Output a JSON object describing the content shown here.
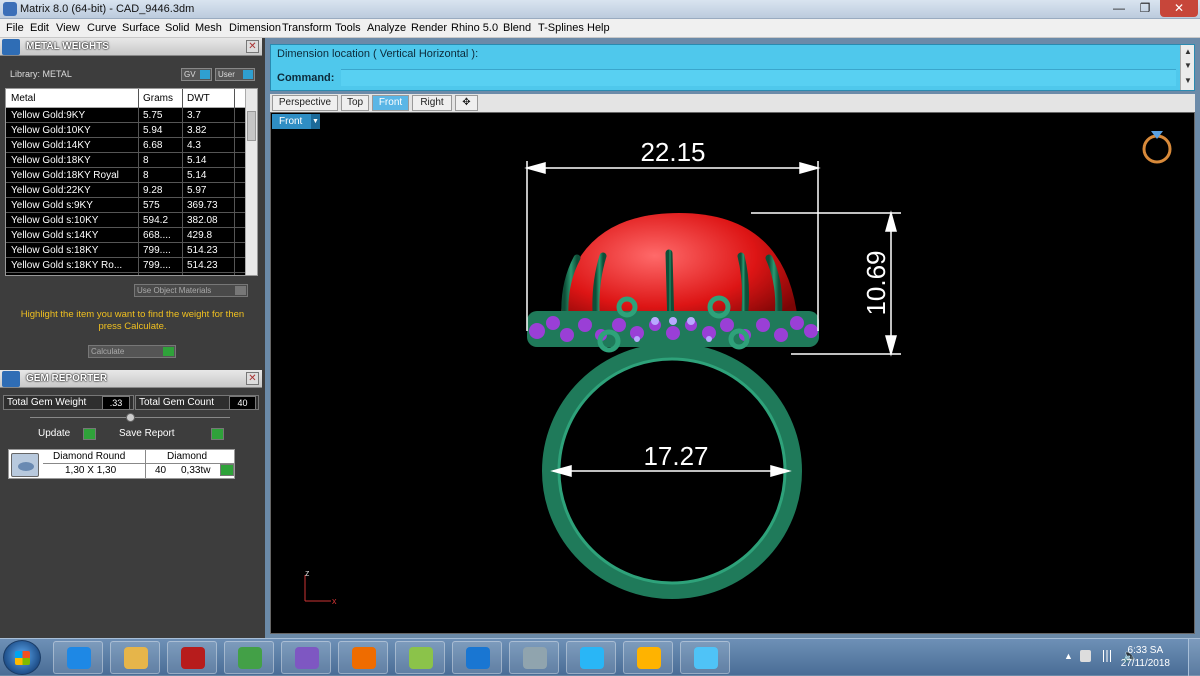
{
  "window": {
    "title": "Matrix 8.0 (64-bit) - CAD_9446.3dm",
    "minimize": "—",
    "maximize": "❐",
    "close": "✕"
  },
  "menu": [
    "File",
    "Edit",
    "View",
    "Curve",
    "Surface",
    "Solid",
    "Mesh",
    "Dimension",
    "Transform",
    "Tools",
    "Analyze",
    "Render",
    "Rhino 5.0",
    "Blend",
    "T-Splines",
    "Help"
  ],
  "metal_weights": {
    "title": "METAL WEIGHTS",
    "library_label": "Library: METAL",
    "gv_label": "GV",
    "user_label": "User",
    "columns": [
      "Metal",
      "Grams",
      "DWT"
    ],
    "rows": [
      [
        "Yellow Gold:9KY",
        "5.75",
        "3.7"
      ],
      [
        "Yellow Gold:10KY",
        "5.94",
        "3.82"
      ],
      [
        "Yellow Gold:14KY",
        "6.68",
        "4.3"
      ],
      [
        "Yellow Gold:18KY",
        "8",
        "5.14"
      ],
      [
        "Yellow Gold:18KY Royal",
        "8",
        "5.14"
      ],
      [
        "Yellow Gold:22KY",
        "9.28",
        "5.97"
      ],
      [
        "Yellow Gold s:9KY",
        "575",
        "369.73"
      ],
      [
        "Yellow Gold s:10KY",
        "594.2",
        "382.08"
      ],
      [
        "Yellow Gold s:14KY",
        "668....",
        "429.8"
      ],
      [
        "Yellow Gold s:18KY",
        "799....",
        "514.23"
      ],
      [
        "Yellow Gold s:18KY Ro...",
        "799....",
        "514.23"
      ]
    ],
    "use_object_materials": "Use Object Materials",
    "hint": "Highlight the item you want to find the weight for then press Calculate.",
    "calculate": "Calculate"
  },
  "gem_reporter": {
    "title": "GEM REPORTER",
    "total_weight_label": "Total Gem Weight",
    "total_weight_value": ".33",
    "total_count_label": "Total Gem Count",
    "total_count_value": "40",
    "update": "Update",
    "save_report": "Save Report",
    "gem": {
      "shape": "Diamond Round",
      "size": "1,30 X 1,30",
      "type": "Diamond",
      "count": "40",
      "weight": "0,33tw"
    }
  },
  "command": {
    "prompt": "Dimension location ( Vertical  Horizontal ):",
    "label": "Command:"
  },
  "viewport_tabs": [
    {
      "label": "Perspective",
      "active": false
    },
    {
      "label": "Top",
      "active": false
    },
    {
      "label": "Front",
      "active": true
    },
    {
      "label": "Right",
      "active": false
    },
    {
      "label": "✥",
      "active": false
    }
  ],
  "viewport": {
    "name": "Front",
    "dim_width": "22.15",
    "dim_height": "10.69",
    "dim_inner": "17.27",
    "axis_z": "z",
    "axis_x": "x",
    "colors": {
      "gem": "#dd1515",
      "metal": "#1f7a5a",
      "accent_gem": "#9a3fd6",
      "dim": "#ffffff"
    }
  },
  "taskbar": {
    "clock_time": "6:33 SA",
    "clock_date": "27/11/2018",
    "apps": [
      {
        "name": "internet-explorer-icon",
        "color": "#1e88e5"
      },
      {
        "name": "file-explorer-icon",
        "color": "#e6b54a"
      },
      {
        "name": "garena-icon",
        "color": "#b71c1c"
      },
      {
        "name": "chrome-icon",
        "color": "#43a047"
      },
      {
        "name": "viber-icon",
        "color": "#7e57c2"
      },
      {
        "name": "media-player-icon",
        "color": "#ef6c00"
      },
      {
        "name": "coccoc-icon",
        "color": "#8bc34a"
      },
      {
        "name": "zalo-icon",
        "color": "#1976d2"
      },
      {
        "name": "control-panel-icon",
        "color": "#90a4ae"
      },
      {
        "name": "v8-icon",
        "color": "#29b6f6"
      },
      {
        "name": "paint-icon",
        "color": "#ffb300"
      },
      {
        "name": "matrix-icon",
        "color": "#4fc3f7"
      }
    ]
  }
}
